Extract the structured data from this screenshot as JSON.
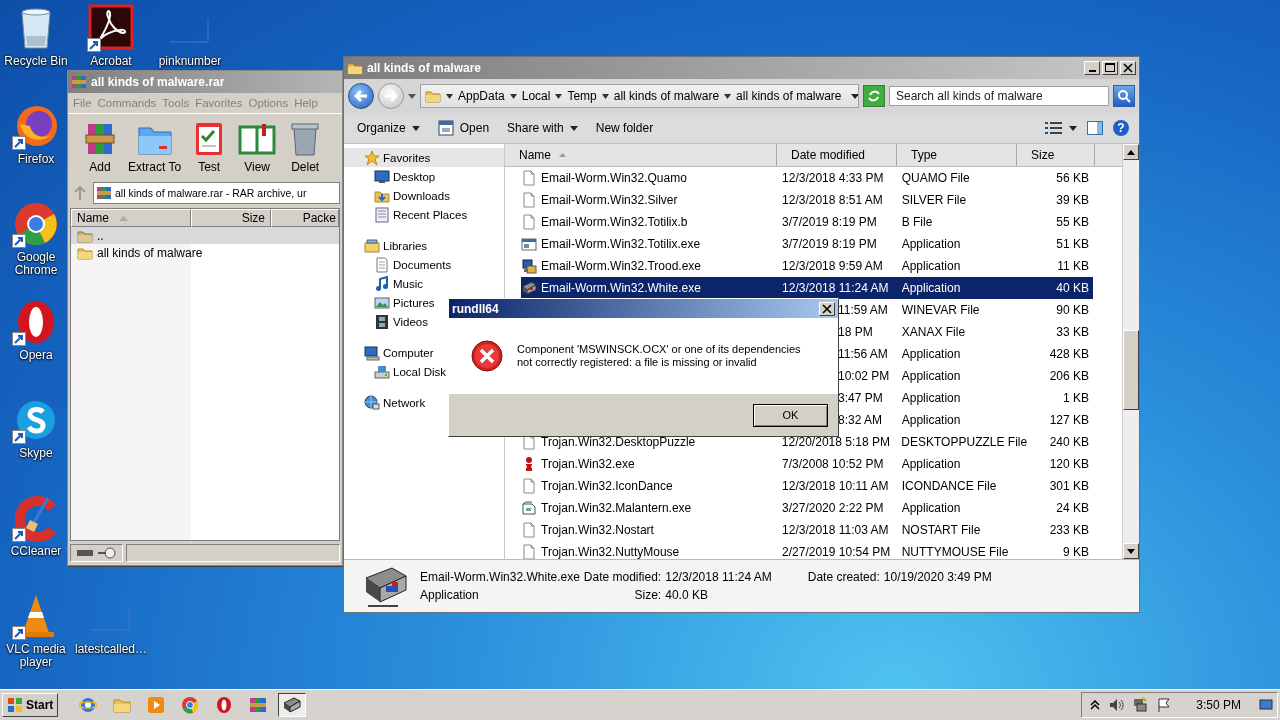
{
  "desktop_icons": [
    {
      "label": "Recycle Bin",
      "kind": "recycle",
      "shortcut": false
    },
    {
      "label": "Acrobat",
      "kind": "acrobat",
      "shortcut": true
    },
    {
      "label": "pinknumber",
      "kind": "blank",
      "shortcut": false
    },
    {
      "label": "Firefox",
      "kind": "firefox",
      "shortcut": true
    },
    {
      "label": "Google Chrome",
      "kind": "chrome",
      "shortcut": true
    },
    {
      "label": "Opera",
      "kind": "opera",
      "shortcut": true
    },
    {
      "label": "Skype",
      "kind": "skype",
      "shortcut": true
    },
    {
      "label": "CCleaner",
      "kind": "ccleaner",
      "shortcut": true
    },
    {
      "label": "VLC media player",
      "kind": "vlc",
      "shortcut": true
    },
    {
      "label": "latestcalled…",
      "kind": "blank",
      "shortcut": false
    }
  ],
  "winrar": {
    "title": "all kinds of malware.rar",
    "menu": [
      "File",
      "Commands",
      "Tools",
      "Favorites",
      "Options",
      "Help"
    ],
    "tools": [
      {
        "label": "Add",
        "kind": "add"
      },
      {
        "label": "Extract To",
        "kind": "extract"
      },
      {
        "label": "Test",
        "kind": "test"
      },
      {
        "label": "View",
        "kind": "view"
      },
      {
        "label": "Delet",
        "kind": "delete"
      }
    ],
    "address": "all kinds of malware.rar - RAR archive, ur",
    "columns": [
      {
        "label": "Name",
        "sorted": true
      },
      {
        "label": "Size",
        "sorted": false
      },
      {
        "label": "Packe",
        "sorted": false
      }
    ],
    "rows": [
      {
        "name": "..",
        "kind": "up",
        "selected": true
      },
      {
        "name": "all kinds of malware",
        "kind": "folder",
        "selected": false
      }
    ]
  },
  "explorer": {
    "title": "all kinds of malware",
    "breadcrumbs": [
      "AppData",
      "Local",
      "Temp",
      "all kinds of malware",
      "all kinds of malware"
    ],
    "search": {
      "placeholder": "Search all kinds of malware"
    },
    "toolbar": [
      {
        "label": "Organize",
        "kind": "menu"
      },
      {
        "label": "Open",
        "kind": "action"
      },
      {
        "label": "Share with",
        "kind": "menu"
      },
      {
        "label": "New folder",
        "kind": "plain"
      }
    ],
    "help": "?",
    "nav": [
      {
        "label": "Favorites",
        "kind": "star",
        "selected": true,
        "children": [
          {
            "label": "Desktop",
            "kind": "desktop",
            "selected": false
          },
          {
            "label": "Downloads",
            "kind": "downloads",
            "selected": false
          },
          {
            "label": "Recent Places",
            "kind": "recent",
            "selected": false
          }
        ]
      },
      {
        "label": "Libraries",
        "kind": "libraries",
        "selected": false,
        "children": [
          {
            "label": "Documents",
            "kind": "document",
            "selected": false
          },
          {
            "label": "Music",
            "kind": "music",
            "selected": false
          },
          {
            "label": "Pictures",
            "kind": "pictures",
            "selected": false
          },
          {
            "label": "Videos",
            "kind": "videos",
            "selected": false
          }
        ]
      },
      {
        "label": "Computer",
        "kind": "computer",
        "selected": false,
        "children": [
          {
            "label": "Local Disk",
            "kind": "disk",
            "selected": false
          }
        ]
      },
      {
        "label": "Network",
        "kind": "network",
        "selected": false
      }
    ],
    "columns": [
      {
        "label": "Name",
        "sorted": true
      },
      {
        "label": "Date modified",
        "sorted": false
      },
      {
        "label": "Type",
        "sorted": false
      },
      {
        "label": "Size",
        "sorted": false
      }
    ],
    "rows": [
      {
        "name": "Email-Worm.Win32.Quamo",
        "date": "12/3/2018 4:33 PM",
        "type": "QUAMO File",
        "size": "56 KB",
        "kind": "file",
        "selected": false
      },
      {
        "name": "Email-Worm.Win32.Silver",
        "date": "12/3/2018 8:51 AM",
        "type": "SILVER File",
        "size": "39 KB",
        "kind": "file",
        "selected": false
      },
      {
        "name": "Email-Worm.Win32.Totilix.b",
        "date": "3/7/2019 8:19 PM",
        "type": "B File",
        "size": "55 KB",
        "kind": "file",
        "selected": false
      },
      {
        "name": "Email-Worm.Win32.Totilix.exe",
        "date": "3/7/2019 8:19 PM",
        "type": "Application",
        "size": "51 KB",
        "kind": "window",
        "selected": false
      },
      {
        "name": "Email-Worm.Win32.Trood.exe",
        "date": "12/3/2018 9:59 AM",
        "type": "Application",
        "size": "11 KB",
        "kind": "setup",
        "selected": false
      },
      {
        "name": "Email-Worm.Win32.White.exe",
        "date": "12/3/2018 11:24 AM",
        "type": "Application",
        "size": "40 KB",
        "kind": "device",
        "selected": true
      },
      {
        "date": "11:59 AM",
        "type": "WINEVAR File",
        "size": "90 KB",
        "kind": "covered",
        "selected": false
      },
      {
        "date": "18 PM",
        "type": "XANAX File",
        "size": "33 KB",
        "kind": "covered",
        "selected": false
      },
      {
        "date": "11:56 AM",
        "type": "Application",
        "size": "428 KB",
        "kind": "covered",
        "selected": false
      },
      {
        "date": "10:02 PM",
        "type": "Application",
        "size": "206 KB",
        "kind": "covered",
        "selected": false
      },
      {
        "date": "3:47 PM",
        "type": "Application",
        "size": "1 KB",
        "kind": "covered",
        "selected": false
      },
      {
        "date": "8:32 AM",
        "type": "Application",
        "size": "127 KB",
        "kind": "covered",
        "selected": false
      },
      {
        "name": "Trojan.Win32.DesktopPuzzle",
        "date": "12/20/2018 5:18 PM",
        "type": "DESKTOPPUZZLE File",
        "size": "240 KB",
        "kind": "file",
        "selected": false
      },
      {
        "name": "Trojan.Win32.exe",
        "date": "7/3/2008 10:52 PM",
        "type": "Application",
        "size": "120 KB",
        "kind": "figure",
        "selected": false
      },
      {
        "name": "Trojan.Win32.IconDance",
        "date": "12/3/2018 10:11 AM",
        "type": "ICONDANCE File",
        "size": "301 KB",
        "kind": "file",
        "selected": false
      },
      {
        "name": "Trojan.Win32.Malantern.exe",
        "date": "3/27/2020 2:22 PM",
        "type": "Application",
        "size": "24 KB",
        "kind": "box",
        "selected": false
      },
      {
        "name": "Trojan.Win32.Nostart",
        "date": "12/3/2018 11:03 AM",
        "type": "NOSTART File",
        "size": "233 KB",
        "kind": "file",
        "selected": false
      },
      {
        "name": "Trojan.Win32.NuttyMouse",
        "date": "2/27/2019 10:54 PM",
        "type": "NUTTYMOUSE File",
        "size": "9 KB",
        "kind": "file",
        "selected": false
      }
    ],
    "details": {
      "name": "Email-Worm.Win32.White.exe",
      "type": "Application",
      "modified_label": "Date modified:",
      "modified": "12/3/2018 11:24 AM",
      "created_label": "Date created:",
      "created": "10/19/2020 3:49 PM",
      "size_label": "Size:",
      "size": "40.0 KB"
    }
  },
  "dialog": {
    "title": "rundll64",
    "message": "Component 'MSWINSCK.OCX' or one of its dependencies not correctly registered: a file is missing or invalid",
    "button": "OK"
  },
  "taskbar": {
    "start": "Start",
    "apps": [
      {
        "kind": "ie",
        "selected": false
      },
      {
        "kind": "folder",
        "selected": false
      },
      {
        "kind": "media",
        "selected": false
      },
      {
        "kind": "chrome",
        "selected": false
      },
      {
        "kind": "opera",
        "selected": false
      },
      {
        "kind": "winrar",
        "selected": false
      },
      {
        "kind": "device",
        "selected": true
      }
    ],
    "clock": "3:50 PM"
  }
}
